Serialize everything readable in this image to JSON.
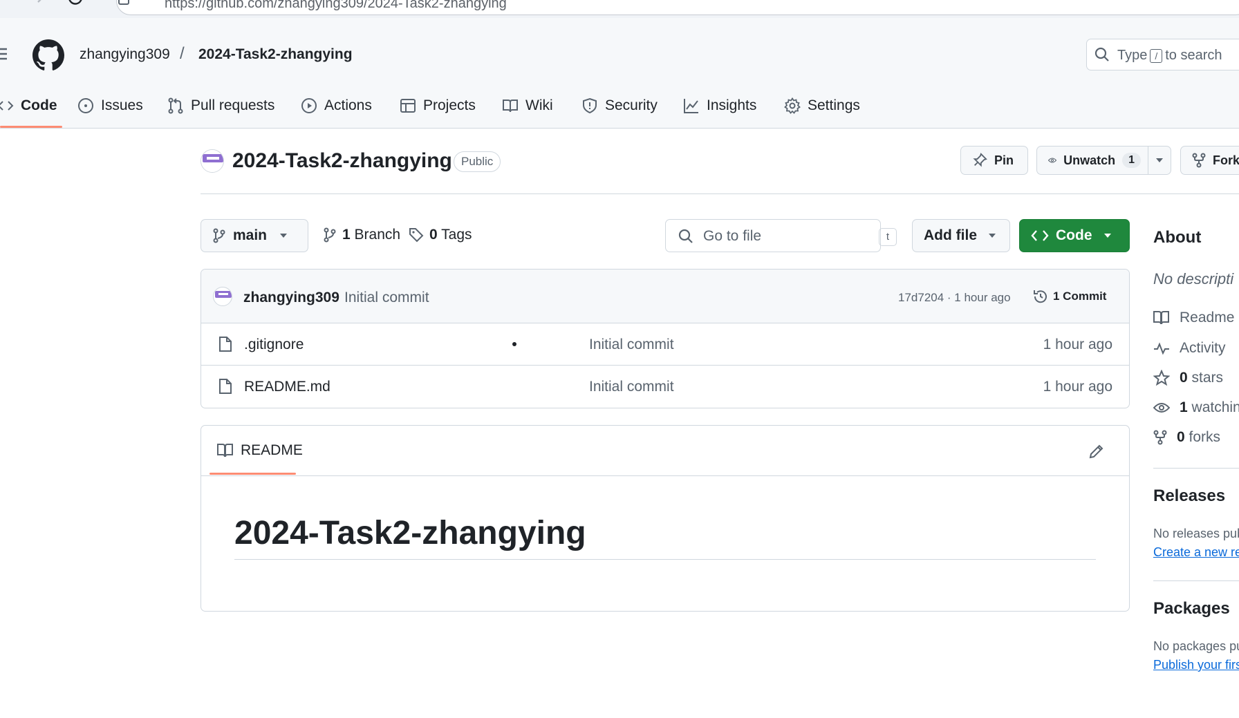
{
  "browser": {
    "url": "https://github.com/zhangying309/2024-Task2-zhangying"
  },
  "header": {
    "owner": "zhangying309",
    "separator": "/",
    "repo": "2024-Task2-zhangying",
    "search_prefix": "Type",
    "search_key": "/",
    "search_suffix": "to search"
  },
  "nav": {
    "tabs": [
      {
        "label": "Code",
        "icon": "code-icon",
        "active": true
      },
      {
        "label": "Issues",
        "icon": "issue-icon"
      },
      {
        "label": "Pull requests",
        "icon": "pull-request-icon"
      },
      {
        "label": "Actions",
        "icon": "play-icon"
      },
      {
        "label": "Projects",
        "icon": "table-icon"
      },
      {
        "label": "Wiki",
        "icon": "book-icon"
      },
      {
        "label": "Security",
        "icon": "shield-icon"
      },
      {
        "label": "Insights",
        "icon": "graph-icon"
      },
      {
        "label": "Settings",
        "icon": "gear-icon"
      }
    ]
  },
  "repo": {
    "title": "2024-Task2-zhangying",
    "visibility": "Public",
    "pin_label": "Pin",
    "unwatch_label": "Unwatch",
    "watch_count": "1",
    "fork_label": "Fork"
  },
  "branch_bar": {
    "branch": "main",
    "branch_count": "1",
    "branch_label": "Branch",
    "tag_count": "0",
    "tag_label": "Tags",
    "goto_placeholder": "Go to file",
    "goto_key": "t",
    "add_file": "Add file",
    "code_button": "Code"
  },
  "latest_commit": {
    "author": "zhangying309",
    "message": "Initial commit",
    "meta": "17d7204 · 1 hour ago",
    "commit_count": "1 Commit"
  },
  "files": [
    {
      "name": ".gitignore",
      "message": "Initial commit",
      "time": "1 hour ago"
    },
    {
      "name": "README.md",
      "message": "Initial commit",
      "time": "1 hour ago"
    }
  ],
  "readme": {
    "tab_label": "README",
    "heading": "2024-Task2-zhangying"
  },
  "sidebar": {
    "about_title": "About",
    "description": "No descripti",
    "items": [
      {
        "icon": "book-icon",
        "label": "Readme"
      },
      {
        "icon": "pulse-icon",
        "label": "Activity"
      },
      {
        "icon": "star-icon",
        "count": "0",
        "label": "stars"
      },
      {
        "icon": "eye-icon",
        "count": "1",
        "label": "watchin"
      },
      {
        "icon": "fork-icon",
        "count": "0",
        "label": "forks"
      }
    ],
    "releases_title": "Releases",
    "releases_text": "No releases pub",
    "releases_link": "Create a new re",
    "packages_title": "Packages",
    "packages_text": "No packages pu",
    "packages_link": "Publish your firs"
  },
  "colors": {
    "accent_green": "#1f883d",
    "tab_underline": "#fd8c73",
    "link_blue": "#0969da",
    "border": "#d0d7de",
    "avatar_purple": "#8f6fd1"
  }
}
